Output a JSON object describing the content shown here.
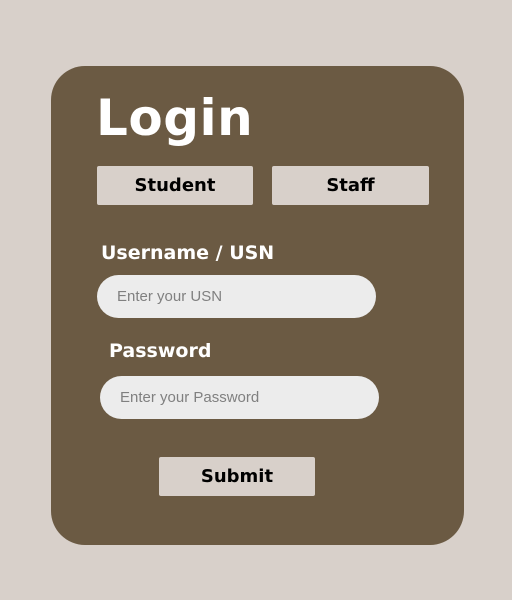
{
  "colors": {
    "page_background": "#d8d0ca",
    "card_background": "#6b5a43",
    "button_background": "#d8d0ca",
    "input_background": "#ececec",
    "heading_text": "#ffffff",
    "button_text": "#000000"
  },
  "login": {
    "title": "Login",
    "roles": {
      "student_label": "Student",
      "staff_label": "Staff"
    },
    "username": {
      "label": "Username / USN",
      "value": "",
      "placeholder": "Enter your USN"
    },
    "password": {
      "label": "Password",
      "value": "",
      "placeholder": "Enter your Password"
    },
    "submit_label": "Submit"
  }
}
